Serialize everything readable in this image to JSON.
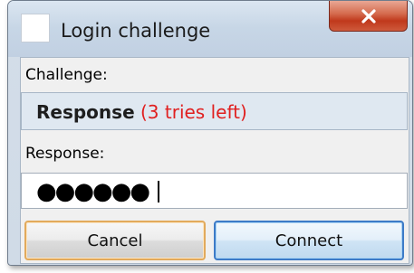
{
  "window": {
    "title": "Login challenge"
  },
  "icons": {
    "close": "close-icon",
    "app": "app-icon"
  },
  "challenge": {
    "label": "Challenge:",
    "text_strong": "Response",
    "text_tries": "(3 tries left)"
  },
  "response": {
    "label": "Response:",
    "value": "●●●●●●"
  },
  "buttons": {
    "cancel": "Cancel",
    "connect": "Connect"
  },
  "colors": {
    "tries_text": "#e02020",
    "close_button": "#c0391c",
    "default_button_border": "#3d7bc7",
    "focused_button_border": "#e2aa5c"
  }
}
